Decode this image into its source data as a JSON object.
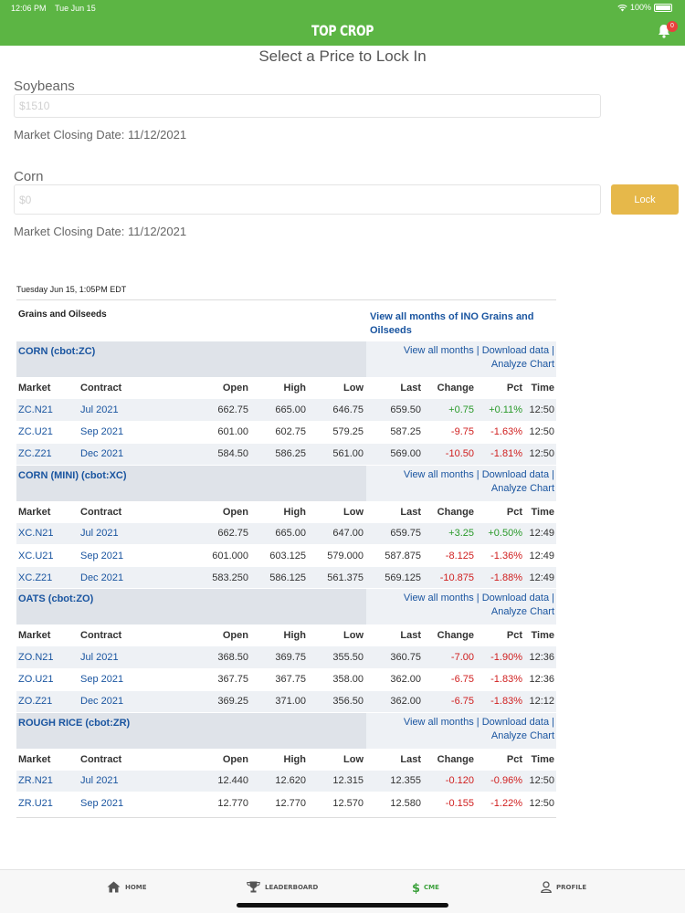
{
  "status_bar": {
    "time": "12:06 PM",
    "date": "Tue Jun 15",
    "battery": "100%"
  },
  "header": {
    "app_title": "TOP CROP",
    "notification_count": "0"
  },
  "page_title": "Select a Price to Lock In",
  "soybeans": {
    "label": "Soybeans",
    "placeholder": "$1510",
    "closing": "Market Closing Date: 11/12/2021"
  },
  "corn": {
    "label": "Corn",
    "placeholder": "$0",
    "closing": "Market Closing Date: 11/12/2021",
    "lock_label": "Lock"
  },
  "quotes": {
    "timestamp": "Tuesday Jun 15, 1:05PM EDT",
    "section_title": "Grains and Oilseeds",
    "section_link": "View all months of INO Grains and Oilseeds",
    "link_view_all": "View all months",
    "link_download": "Download data",
    "link_analyze": "Analyze Chart",
    "separator": "|",
    "columns": {
      "market": "Market",
      "contract": "Contract",
      "open": "Open",
      "high": "High",
      "low": "Low",
      "last": "Last",
      "change": "Change",
      "pct": "Pct",
      "time": "Time"
    },
    "groups": [
      {
        "name": "CORN (cbot:ZC)",
        "rows": [
          {
            "market": "ZC.N21",
            "contract": "Jul 2021",
            "open": "662.75",
            "high": "665.00",
            "low": "646.75",
            "last": "659.50",
            "change": "+0.75",
            "pct": "+0.11%",
            "time": "12:50"
          },
          {
            "market": "ZC.U21",
            "contract": "Sep 2021",
            "open": "601.00",
            "high": "602.75",
            "low": "579.25",
            "last": "587.25",
            "change": "-9.75",
            "pct": "-1.63%",
            "time": "12:50"
          },
          {
            "market": "ZC.Z21",
            "contract": "Dec 2021",
            "open": "584.50",
            "high": "586.25",
            "low": "561.00",
            "last": "569.00",
            "change": "-10.50",
            "pct": "-1.81%",
            "time": "12:50"
          }
        ]
      },
      {
        "name": "CORN (MINI) (cbot:XC)",
        "rows": [
          {
            "market": "XC.N21",
            "contract": "Jul 2021",
            "open": "662.75",
            "high": "665.00",
            "low": "647.00",
            "last": "659.75",
            "change": "+3.25",
            "pct": "+0.50%",
            "time": "12:49"
          },
          {
            "market": "XC.U21",
            "contract": "Sep 2021",
            "open": "601.000",
            "high": "603.125",
            "low": "579.000",
            "last": "587.875",
            "change": "-8.125",
            "pct": "-1.36%",
            "time": "12:49"
          },
          {
            "market": "XC.Z21",
            "contract": "Dec 2021",
            "open": "583.250",
            "high": "586.125",
            "low": "561.375",
            "last": "569.125",
            "change": "-10.875",
            "pct": "-1.88%",
            "time": "12:49"
          }
        ]
      },
      {
        "name": "OATS (cbot:ZO)",
        "rows": [
          {
            "market": "ZO.N21",
            "contract": "Jul 2021",
            "open": "368.50",
            "high": "369.75",
            "low": "355.50",
            "last": "360.75",
            "change": "-7.00",
            "pct": "-1.90%",
            "time": "12:36"
          },
          {
            "market": "ZO.U21",
            "contract": "Sep 2021",
            "open": "367.75",
            "high": "367.75",
            "low": "358.00",
            "last": "362.00",
            "change": "-6.75",
            "pct": "-1.83%",
            "time": "12:36"
          },
          {
            "market": "ZO.Z21",
            "contract": "Dec 2021",
            "open": "369.25",
            "high": "371.00",
            "low": "356.50",
            "last": "362.00",
            "change": "-6.75",
            "pct": "-1.83%",
            "time": "12:12"
          }
        ]
      },
      {
        "name": "ROUGH RICE (cbot:ZR)",
        "rows": [
          {
            "market": "ZR.N21",
            "contract": "Jul 2021",
            "open": "12.440",
            "high": "12.620",
            "low": "12.315",
            "last": "12.355",
            "change": "-0.120",
            "pct": "-0.96%",
            "time": "12:50"
          },
          {
            "market": "ZR.U21",
            "contract": "Sep 2021",
            "open": "12.770",
            "high": "12.770",
            "low": "12.570",
            "last": "12.580",
            "change": "-0.155",
            "pct": "-1.22%",
            "time": "12:50"
          }
        ]
      }
    ]
  },
  "tabs": [
    {
      "label": "HOME",
      "icon": "home-icon"
    },
    {
      "label": "LEADERBOARD",
      "icon": "trophy-icon"
    },
    {
      "label": "CME",
      "icon": "dollar-icon",
      "active": true
    },
    {
      "label": "PROFILE",
      "icon": "profile-icon"
    }
  ],
  "colors": {
    "brand_green": "#5cb544",
    "lock_button": "#e6b84a",
    "link_blue": "#1a55a0",
    "positive": "#2a9a2a",
    "negative": "#d02020"
  }
}
